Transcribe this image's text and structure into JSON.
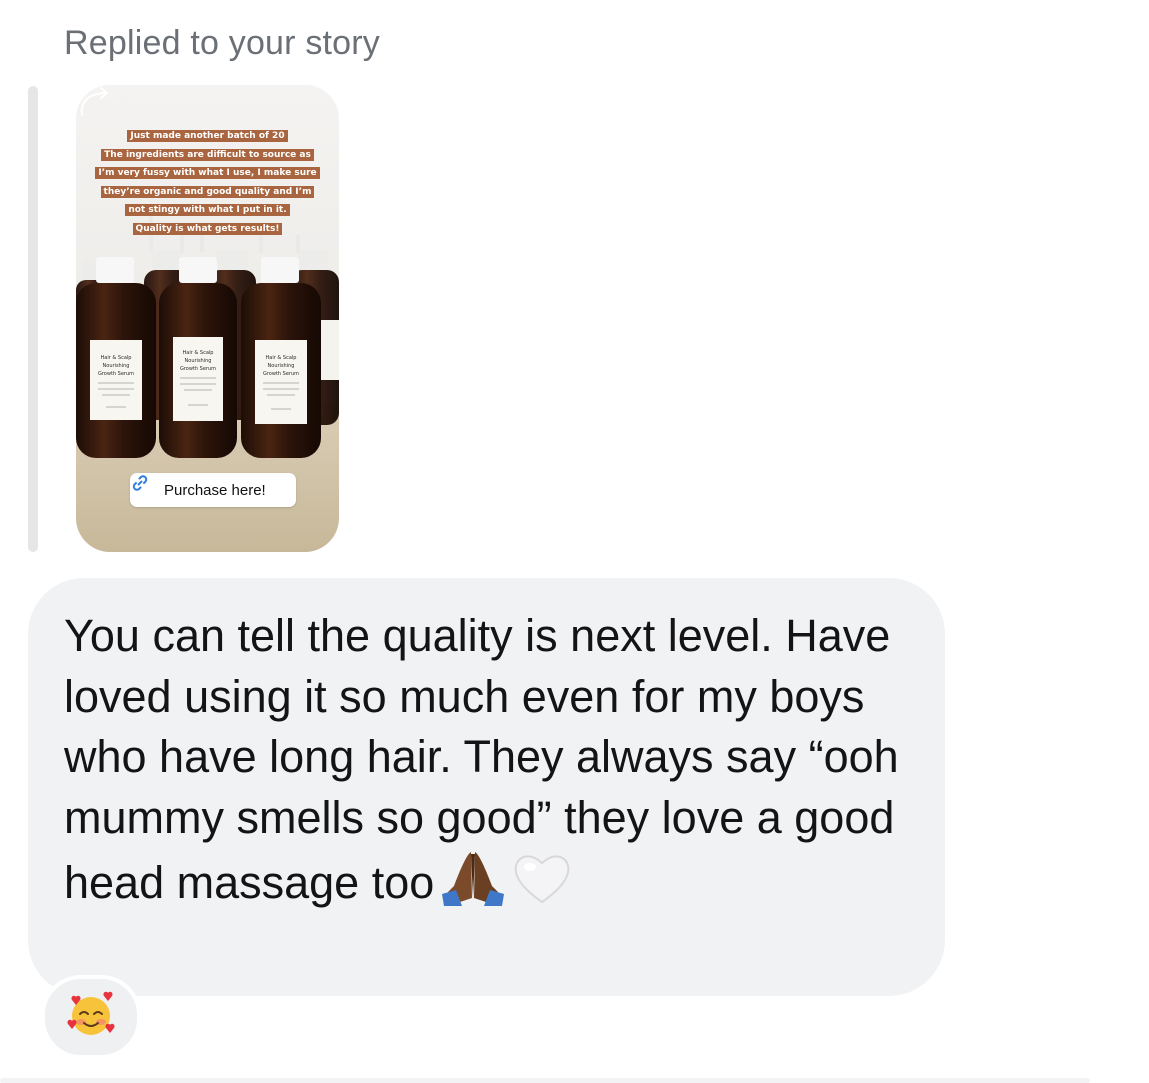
{
  "reply_header": "Replied to your story",
  "story": {
    "caption_lines": [
      "Just made another batch of 20",
      "The ingredients are difficult to source as",
      "I’m very fussy with what I use, I make sure",
      "they’re organic and good quality and I’m",
      "not stingy with what I put in it.",
      "Quality is what gets results!"
    ],
    "bottle_label_title": [
      "Hair & Scalp",
      "Nourishing",
      "Growth Serum"
    ],
    "link_sticker_label": "Purchase here!",
    "colors": {
      "caption_bg": "#a8653f",
      "bottle": "#3a1c0f",
      "link_icon": "#2f7de1"
    }
  },
  "message": {
    "text": "You can tell the quality is next level. Have loved using it so much even for my boys who have long hair. They always say “ooh mummy smells so good” they love a good head massage too",
    "trailing_emojis": [
      "folded-hands-medium-dark-skin-tone",
      "white-heart"
    ]
  },
  "reaction": {
    "emoji": "smiling-face-with-hearts"
  },
  "colors": {
    "bubble_bg": "#f1f2f4",
    "header_text": "#6b6f76",
    "message_text": "#141416"
  }
}
